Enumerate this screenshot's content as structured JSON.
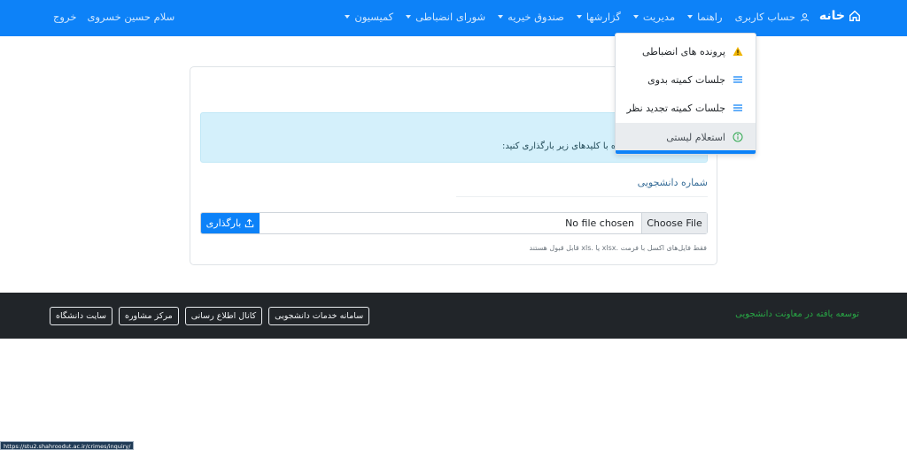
{
  "navbar": {
    "brand": "خانه",
    "items": [
      {
        "label": "کمیسیون",
        "dropdown": true
      },
      {
        "label": "شورای انضباطی",
        "dropdown": true
      },
      {
        "label": "صندوق خیریه",
        "dropdown": true
      },
      {
        "label": "گزارشها",
        "dropdown": true
      },
      {
        "label": "مدیریت",
        "dropdown": true
      },
      {
        "label": "راهنما",
        "dropdown": true
      },
      {
        "label": "حساب کاربری",
        "icon": "user-icon"
      }
    ],
    "greeting": "سلام حسین خسروی",
    "logout": "خروج"
  },
  "dropdown": {
    "items": [
      {
        "label": "پرونده های انضباطی",
        "icon": "warning-icon"
      },
      {
        "label": "جلسات کمیته بدوی",
        "icon": "list-icon"
      },
      {
        "label": "جلسات کمیته تجدید نظر",
        "icon": "list-icon"
      },
      {
        "label": "استعلام لیستی",
        "icon": "info-icon",
        "active": true
      }
    ]
  },
  "card": {
    "alert_text": "ی شبیه ساختار پایگاه داده با کلیدهای زیر بارگذاری کنید:",
    "field_label": "شماره دانشجویی",
    "upload_label": "بارگذاری",
    "file_name": "No file chosen",
    "choose_label": "Choose File",
    "help_text": "فقط فایل‌های اکسل با فرمت .xlsx یا .xls قابل قبول هستند"
  },
  "footer": {
    "text": "توسعه یافته در معاونت دانشجویی",
    "buttons": [
      "سامانه خدمات دانشجویی",
      "کانال اطلاع رسانی",
      "مرکز مشاوره",
      "سایت دانشگاه"
    ]
  },
  "status_url": "https://stu2.shahroodut.ac.ir/crimes/inquiry/",
  "colors": {
    "primary": "#0d82f8",
    "footer_bg": "#212529",
    "alert_bg": "#d4f0fb",
    "accent_green": "#28a745"
  }
}
